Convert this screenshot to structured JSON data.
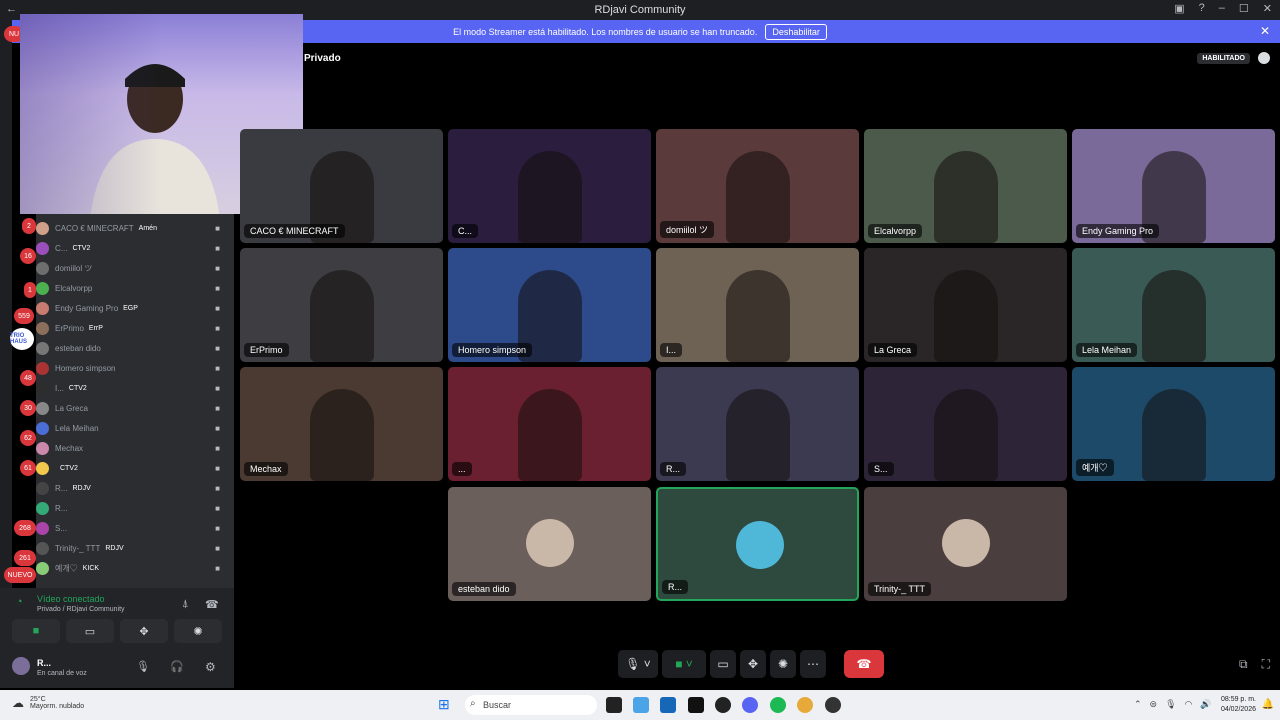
{
  "window": {
    "title": "RDjavi Community"
  },
  "banner": {
    "text": "El modo Streamer está habilitado. Los nombres de usuario se han truncado.",
    "button": "Deshabilitar"
  },
  "channel": {
    "title": "Privado",
    "streamer_badge": "HABILITADO"
  },
  "server_badges": [
    "NU",
    "2",
    "16",
    "1",
    "559",
    "48",
    "30",
    "62",
    "61",
    "268",
    "261",
    "NUEVO"
  ],
  "server_labels": [
    "TRIO HAUS"
  ],
  "members": [
    {
      "name": "CACO € MINECRAFT",
      "badge": "Amén",
      "color": "#d1a08a"
    },
    {
      "name": "C...",
      "badge": "CTV2",
      "color": "#9a4fbd"
    },
    {
      "name": "domiilol ツ",
      "badge": "",
      "color": "#6e6e6e"
    },
    {
      "name": "Elcalvorpp",
      "badge": "",
      "color": "#4caf50"
    },
    {
      "name": "Endy Gaming Pro",
      "badge": "EGP",
      "color": "#c87b6f"
    },
    {
      "name": "ErPrimo",
      "badge": "ErrP",
      "color": "#8b6f5a"
    },
    {
      "name": "esteban dido",
      "badge": "",
      "color": "#777"
    },
    {
      "name": "Homero simpson",
      "badge": "",
      "color": "#a33"
    },
    {
      "name": "I...",
      "badge": "CTV2",
      "color": "#2d2d2d"
    },
    {
      "name": "La Greca",
      "badge": "",
      "color": "#888"
    },
    {
      "name": "Lela Meihan",
      "badge": "",
      "color": "#4a6dd6"
    },
    {
      "name": "Mechax",
      "badge": "",
      "color": "#c8a"
    },
    {
      "name": "",
      "badge": "CTV2",
      "color": "#f2c94c"
    },
    {
      "name": "R...",
      "badge": "RDJV",
      "color": "#444"
    },
    {
      "name": "R...",
      "badge": "",
      "color": "#3a7"
    },
    {
      "name": "S...",
      "badge": "",
      "color": "#a4a"
    },
    {
      "name": "Trinity-_ TTT",
      "badge": "RDJV",
      "color": "#555"
    },
    {
      "name": "예개♡",
      "badge": "KICK",
      "color": "#8c7"
    }
  ],
  "voice": {
    "status": "Vídeo conectado",
    "path": "Privado / RDjavi Community",
    "user": "R...",
    "user_status": "En canal de voz"
  },
  "tiles": [
    {
      "label": "CACO € MINECRAFT",
      "bg": "#3a3b40"
    },
    {
      "label": "C...",
      "bg": "#2a1d3d"
    },
    {
      "label": "domiilol ツ",
      "bg": "#5a3a3a"
    },
    {
      "label": "Elcalvorpp",
      "bg": "#4c5a4c"
    },
    {
      "label": "Endy Gaming Pro",
      "bg": "#7a6a9a"
    },
    {
      "label": "ErPrimo",
      "bg": "#3d3d42"
    },
    {
      "label": "Homero simpson",
      "bg": "#2d4a8a"
    },
    {
      "label": "I...",
      "bg": "#6e6255"
    },
    {
      "label": "La Greca",
      "bg": "#2a2628"
    },
    {
      "label": "Lela Meihan",
      "bg": "#3a5a55"
    },
    {
      "label": "Mechax",
      "bg": "#4a3a32"
    },
    {
      "label": "...",
      "bg": "#6a2030"
    },
    {
      "label": "R...",
      "bg": "#3c3a50"
    },
    {
      "label": "S...",
      "bg": "#2e2438"
    },
    {
      "label": "예개♡",
      "bg": "#1e4a6a"
    },
    {
      "label": "esteban dido",
      "bg": "#6b5f5c"
    },
    {
      "label": "R...",
      "bg": "#2e4a3e"
    },
    {
      "label": "Trinity-_ TTT",
      "bg": "#4a3e3e"
    }
  ],
  "taskbar": {
    "weather_temp": "25°C",
    "weather_desc": "Mayorm. nublado",
    "search": "Buscar",
    "time": "08:59 p. m.",
    "date": "04/02/2026"
  }
}
